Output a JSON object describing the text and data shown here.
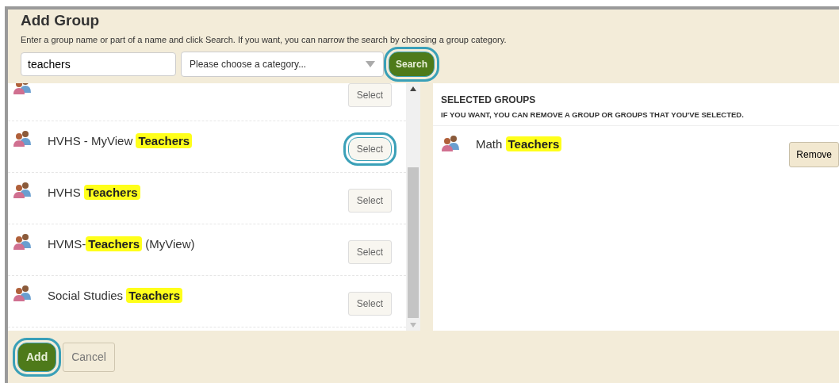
{
  "dialog": {
    "title": "Add Group",
    "instructions": "Enter a group name or part of a name and click Search. If you want, you can narrow the search by choosing a group category."
  },
  "search": {
    "value": "teachers",
    "category_placeholder": "Please choose a category...",
    "button": {
      "label": "Search",
      "circled": true
    }
  },
  "results": [
    {
      "cut_off": true,
      "button": {
        "label": "Select",
        "circled": false
      }
    },
    {
      "cut_off": false,
      "name": "HVHS - MyView **Teachers**",
      "button": {
        "label": "Select",
        "circled": true
      }
    },
    {
      "cut_off": false,
      "name": "HVHS **Teachers**",
      "button": {
        "label": "Select",
        "circled": false
      }
    },
    {
      "cut_off": false,
      "name": "HVMS-**Teachers** (MyView)",
      "button": {
        "label": "Select",
        "circled": false
      }
    },
    {
      "cut_off": false,
      "name": "Social Studies **Teachers**",
      "button": {
        "label": "Select",
        "circled": false
      }
    }
  ],
  "selected_groups": {
    "heading": "SELECTED GROUPS",
    "subheading": "IF YOU WANT, YOU CAN REMOVE A GROUP OR GROUPS THAT YOU'VE SELECTED.",
    "items": [
      {
        "name": "Math **Teachers**",
        "button": "Remove"
      }
    ]
  },
  "footer": {
    "buttons": [
      {
        "label": "Add",
        "kind": "primary",
        "circled": true
      },
      {
        "label": "Cancel",
        "kind": "secondary",
        "circled": false
      }
    ]
  }
}
